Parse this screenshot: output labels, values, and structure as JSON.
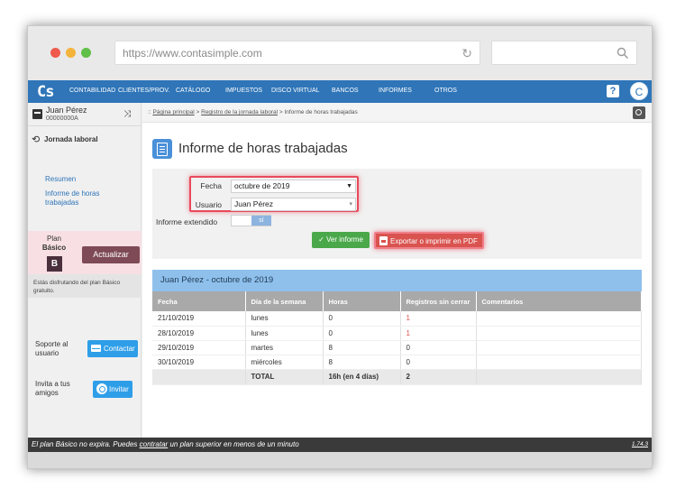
{
  "browser": {
    "url": "https://www.contasimple.com"
  },
  "topnav": {
    "logo": "Cs",
    "items": [
      "CONTABILIDAD",
      "CLIENTES/PROV.",
      "CATÁLOGO",
      "IMPUESTOS",
      "DISCO VIRTUAL",
      "BANCOS",
      "INFORMES",
      "OTROS"
    ],
    "help": "?",
    "avatar_initial": "C"
  },
  "sidebar": {
    "user_name": "Juan Pérez",
    "user_id": "00000000A",
    "section_title": "Jornada laboral",
    "links": [
      "Resumen",
      "Informe de horas trabajadas"
    ],
    "plan": {
      "label_line1": "Plan",
      "label_line2": "Básico",
      "badge": "B",
      "upgrade_label": "Actualizar",
      "note": "Estás disfrutando del plan Básico gratuito."
    },
    "support": {
      "label": "Soporte al usuario",
      "button": "Contactar"
    },
    "invite": {
      "label": "Invita a tus amigos",
      "button": "Invitar"
    }
  },
  "breadcrumb": {
    "prefix": "::",
    "home": "Página principal",
    "sep": ">",
    "parent": "Registro de la jornada laboral",
    "current": "Informe de horas trabajadas"
  },
  "page": {
    "title": "Informe de horas trabajadas"
  },
  "filters": {
    "fecha_label": "Fecha",
    "fecha_value": "octubre de 2019",
    "usuario_label": "Usuario",
    "usuario_value": "Juan Pérez",
    "extendido_label": "Informe extendido",
    "extendido_value": "sí",
    "view_button": "Ver informe",
    "pdf_button": "Exportar o imprimir en PDF"
  },
  "report": {
    "header": "Juan Pérez - octubre de 2019",
    "columns": [
      "Fecha",
      "Día de la semana",
      "Horas",
      "Registros sin cerrar",
      "Comentarios"
    ],
    "rows": [
      [
        "21/10/2019",
        "lunes",
        "0",
        "1",
        ""
      ],
      [
        "28/10/2019",
        "lunes",
        "0",
        "1",
        ""
      ],
      [
        "29/10/2019",
        "martes",
        "8",
        "0",
        ""
      ],
      [
        "30/10/2019",
        "miércoles",
        "8",
        "0",
        ""
      ]
    ],
    "total": [
      "",
      "TOTAL",
      "16h (en 4 días)",
      "2",
      ""
    ]
  },
  "footer": {
    "text_before": "El plan Básico no expira. Puedes",
    "link": "contratar",
    "text_after": "un plan superior en menos de un minuto",
    "version": "1.74.3"
  },
  "colors": {
    "brand_blue": "#2f75b8",
    "highlight_red": "#e84a5c",
    "green": "#4aa84a",
    "plan_bg": "#f7dfe3"
  }
}
